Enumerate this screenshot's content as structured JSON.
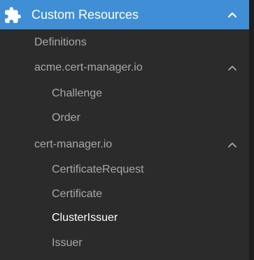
{
  "header": {
    "label": "Custom Resources",
    "icon": "puzzle-icon",
    "toggle_icon": "chevron-up-icon",
    "background": "#3f8ed6"
  },
  "items": {
    "definitions": "Definitions",
    "group_acme": "acme.cert-manager.io",
    "challenge": "Challenge",
    "order": "Order",
    "group_cert_manager": "cert-manager.io",
    "certificate_request": "CertificateRequest",
    "certificate": "Certificate",
    "cluster_issuer": "ClusterIssuer",
    "issuer": "Issuer"
  },
  "colors": {
    "sidebar_bg": "#2b2b2b",
    "text_muted": "#a8a8a8",
    "text_active": "#ffffff"
  }
}
